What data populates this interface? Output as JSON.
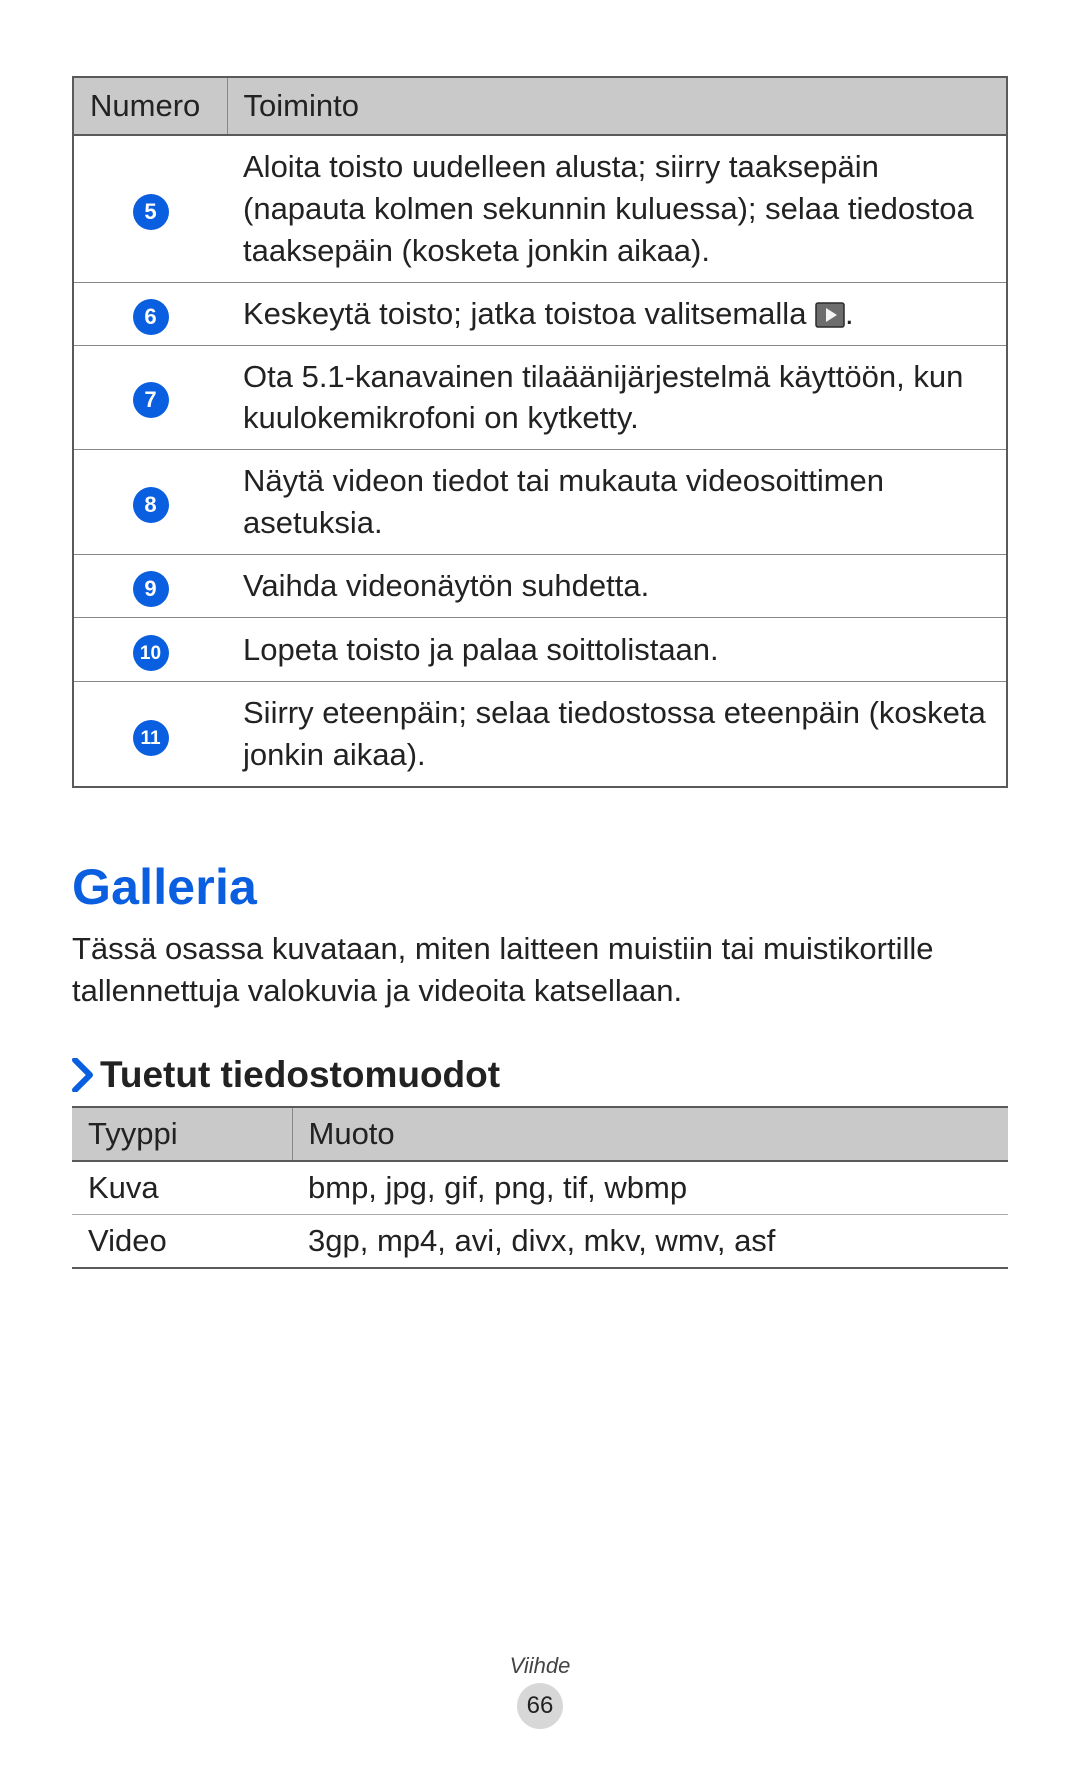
{
  "table1": {
    "headers": {
      "col1": "Numero",
      "col2": "Toiminto"
    },
    "rows": [
      {
        "num": "5",
        "func_pre": "Aloita toisto uudelleen alusta; siirry taaksepäin (napauta kolmen sekunnin kuluessa); selaa tiedostoa taaksepäin (kosketa jonkin aikaa)."
      },
      {
        "num": "6",
        "func_pre": "Keskeytä toisto; jatka toistoa valitsemalla ",
        "has_icon": true,
        "func_post": "."
      },
      {
        "num": "7",
        "func_pre": "Ota 5.1-kanavainen tilaäänijärjestelmä käyttöön, kun kuulokemikrofoni on kytketty."
      },
      {
        "num": "8",
        "func_pre": "Näytä videon tiedot tai mukauta videosoittimen asetuksia."
      },
      {
        "num": "9",
        "func_pre": "Vaihda videonäytön suhdetta."
      },
      {
        "num": "10",
        "func_pre": "Lopeta toisto ja palaa soittolistaan."
      },
      {
        "num": "11",
        "func_pre": "Siirry eteenpäin; selaa tiedostossa eteenpäin (kosketa jonkin aikaa)."
      }
    ]
  },
  "heading": "Galleria",
  "intro": "Tässä osassa kuvataan, miten laitteen muistiin tai muistikortille tallennettuja valokuvia ja videoita katsellaan.",
  "subheading": "Tuetut tiedostomuodot",
  "table2": {
    "headers": {
      "col1": "Tyyppi",
      "col2": "Muoto"
    },
    "rows": [
      {
        "type": "Kuva",
        "format": "bmp, jpg, gif, png, tif, wbmp"
      },
      {
        "type": "Video",
        "format": "3gp, mp4, avi, divx, mkv, wmv, asf"
      }
    ]
  },
  "footer": {
    "section": "Viihde",
    "page": "66"
  }
}
